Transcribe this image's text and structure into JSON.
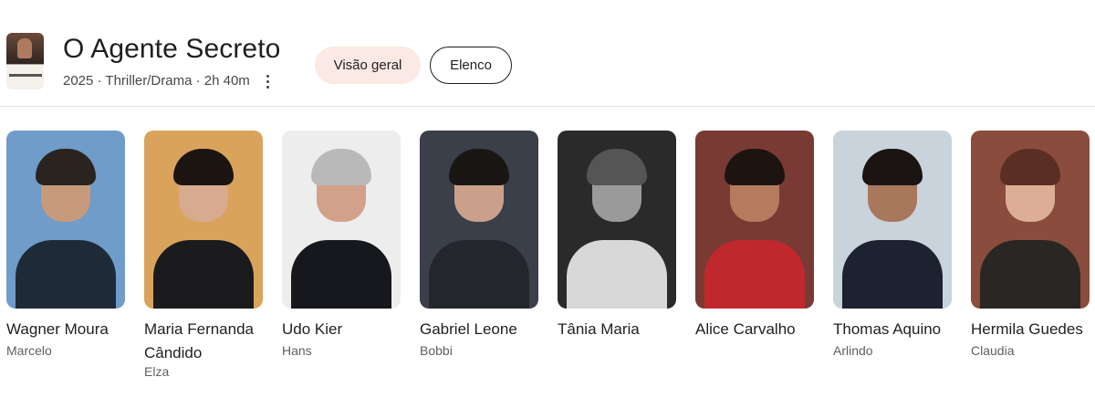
{
  "movie": {
    "title": "O Agente Secreto",
    "meta": "2025 · Thriller/Drama · 2h 40m",
    "poster_caption": "O AGENTE SECRETO"
  },
  "tabs": [
    {
      "label": "Visão geral",
      "selected": false
    },
    {
      "label": "Elenco",
      "selected": true
    }
  ],
  "cast": [
    {
      "name": "Wagner Moura",
      "role": "Marcelo",
      "bg": "#6f9cc9",
      "skin": "#c79a7c",
      "hair": "#2b2320",
      "cloth": "#1f2a38"
    },
    {
      "name": "Maria Fernanda Cândido",
      "role": "Elza",
      "bg": "#d9a35c",
      "skin": "#d7ab8f",
      "hair": "#1c1512",
      "cloth": "#1b1b1d"
    },
    {
      "name": "Udo Kier",
      "role": "Hans",
      "bg": "#ededed",
      "skin": "#d3a08a",
      "hair": "#b9b9b9",
      "cloth": "#16181d"
    },
    {
      "name": "Gabriel Leone",
      "role": "Bobbi",
      "bg": "#3a3f4a",
      "skin": "#caa08a",
      "hair": "#1a1613",
      "cloth": "#23262d"
    },
    {
      "name": "Tânia Maria",
      "role": "",
      "bg": "#2a2a2a",
      "skin": "#9a9a9a",
      "hair": "#555555",
      "cloth": "#d8d8d8"
    },
    {
      "name": "Alice Carvalho",
      "role": "",
      "bg": "#7a3a34",
      "skin": "#b57b5e",
      "hair": "#1e140f",
      "cloth": "#c0282d"
    },
    {
      "name": "Thomas Aquino",
      "role": "Arlindo",
      "bg": "#c9d3dc",
      "skin": "#a9775c",
      "hair": "#1a1412",
      "cloth": "#1c2230"
    },
    {
      "name": "Hermila Guedes",
      "role": "Claudia",
      "bg": "#8a4c3c",
      "skin": "#dcae95",
      "hair": "#5a2e22",
      "cloth": "#2a2623"
    }
  ]
}
